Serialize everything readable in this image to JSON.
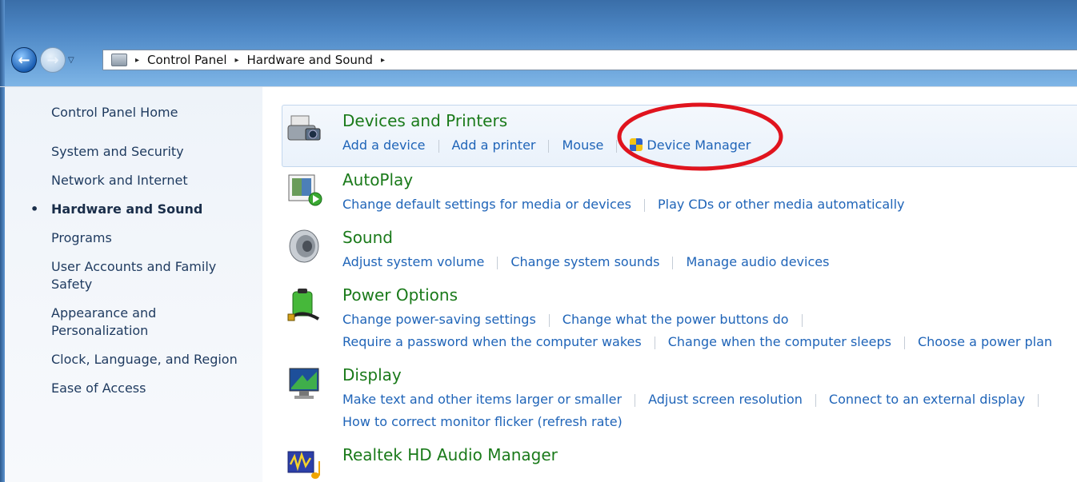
{
  "window": {
    "breadcrumb": [
      "Control Panel",
      "Hardware and Sound"
    ],
    "nav_back_glyph": "←",
    "nav_forward_glyph": "→",
    "nav_dropdown_glyph": "▽",
    "crumb_sep_glyph": "▸"
  },
  "leftnav": {
    "home": "Control Panel Home",
    "items": [
      {
        "label": "System and Security"
      },
      {
        "label": "Network and Internet"
      },
      {
        "label": "Hardware and Sound",
        "current": true
      },
      {
        "label": "Programs"
      },
      {
        "label": "User Accounts and Family Safety"
      },
      {
        "label": "Appearance and Personalization"
      },
      {
        "label": "Clock, Language, and Region"
      },
      {
        "label": "Ease of Access"
      }
    ]
  },
  "categories": [
    {
      "title": "Devices and Printers",
      "icon": "printer-camera-icon",
      "highlighted": true,
      "links": [
        [
          "Add a device",
          "Add a printer",
          "Mouse",
          "Device Manager"
        ]
      ]
    },
    {
      "title": "AutoPlay",
      "icon": "autoplay-icon",
      "links": [
        [
          "Change default settings for media or devices",
          "Play CDs or other media automatically"
        ]
      ]
    },
    {
      "title": "Sound",
      "icon": "speaker-icon",
      "links": [
        [
          "Adjust system volume",
          "Change system sounds",
          "Manage audio devices"
        ]
      ]
    },
    {
      "title": "Power Options",
      "icon": "battery-icon",
      "links": [
        [
          "Change power-saving settings",
          "Change what the power buttons do"
        ],
        [
          "Require a password when the computer wakes",
          "Change when the computer sleeps",
          "Choose a power plan"
        ]
      ]
    },
    {
      "title": "Display",
      "icon": "monitor-icon",
      "links": [
        [
          "Make text and other items larger or smaller",
          "Adjust screen resolution",
          "Connect to an external display"
        ],
        [
          "How to correct monitor flicker (refresh rate)"
        ]
      ]
    },
    {
      "title": "Realtek HD Audio Manager",
      "icon": "audio-manager-icon",
      "links": []
    }
  ],
  "colors": {
    "category_title": "#1a7a1a",
    "link": "#1f64b8",
    "annotation_ellipse": "#e0141e"
  }
}
